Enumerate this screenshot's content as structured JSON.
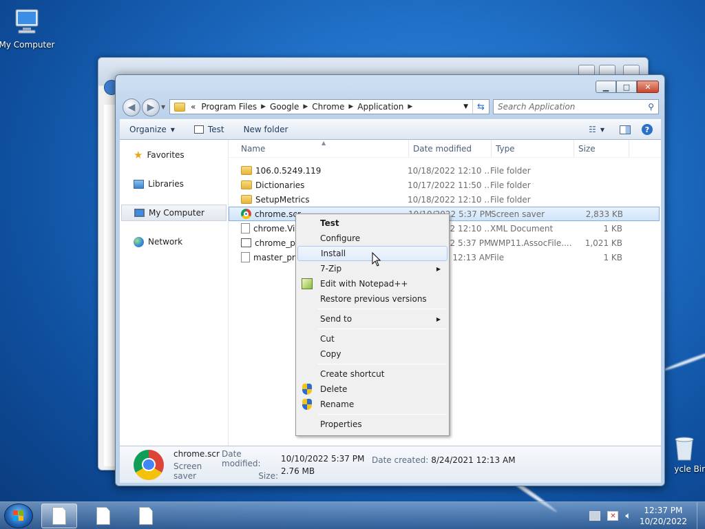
{
  "desktop": {
    "icons": [
      {
        "label": "My Computer"
      },
      {
        "label": "ycle Bin"
      }
    ]
  },
  "window": {
    "address": {
      "prefix": "«",
      "crumbs": [
        "Program Files",
        "Google",
        "Chrome",
        "Application"
      ]
    },
    "search_placeholder": "Search Application",
    "toolbar": {
      "organize": "Organize",
      "test": "Test",
      "new_folder": "New folder"
    },
    "nav": {
      "favorites": "Favorites",
      "libraries": "Libraries",
      "my_computer": "My Computer",
      "network": "Network"
    },
    "columns": {
      "name": "Name",
      "date": "Date modified",
      "type": "Type",
      "size": "Size"
    },
    "files": [
      {
        "name": "106.0.5249.119",
        "date": "10/18/2022 12:10 ...",
        "type": "File folder",
        "size": ""
      },
      {
        "name": "Dictionaries",
        "date": "10/17/2022 11:50 ...",
        "type": "File folder",
        "size": ""
      },
      {
        "name": "SetupMetrics",
        "date": "10/18/2022 12:10 ...",
        "type": "File folder",
        "size": ""
      },
      {
        "name": "chrome.scr",
        "date": "10/10/2022 5:37 PM",
        "type": "Screen saver",
        "size": "2,833 KB"
      },
      {
        "name": "chrome.Vis",
        "date": "10/18/2022 12:10 ...",
        "type": "XML Document",
        "size": "1 KB"
      },
      {
        "name": "chrome_pr",
        "date": "10/10/2022 5:37 PM",
        "type": "WMP11.AssocFile....",
        "size": "1,021 KB"
      },
      {
        "name": "master_pre",
        "date": "8/24/2021 12:13 AM",
        "type": "File",
        "size": "1 KB"
      }
    ],
    "details": {
      "filename": "chrome.scr",
      "filetype": "Screen saver",
      "modified_label": "Date modified:",
      "modified_value": "10/10/2022 5:37 PM",
      "size_label": "Size:",
      "size_value": "2.76 MB",
      "created_label": "Date created:",
      "created_value": "8/24/2021 12:13 AM"
    }
  },
  "context_menu": {
    "test": "Test",
    "configure": "Configure",
    "install": "Install",
    "sevenzip": "7-Zip",
    "notepad": "Edit with Notepad++",
    "restore": "Restore previous versions",
    "send_to": "Send to",
    "cut": "Cut",
    "copy": "Copy",
    "create_shortcut": "Create shortcut",
    "delete": "Delete",
    "rename": "Rename",
    "properties": "Properties"
  },
  "taskbar": {
    "time": "12:37 PM",
    "date": "10/20/2022"
  }
}
